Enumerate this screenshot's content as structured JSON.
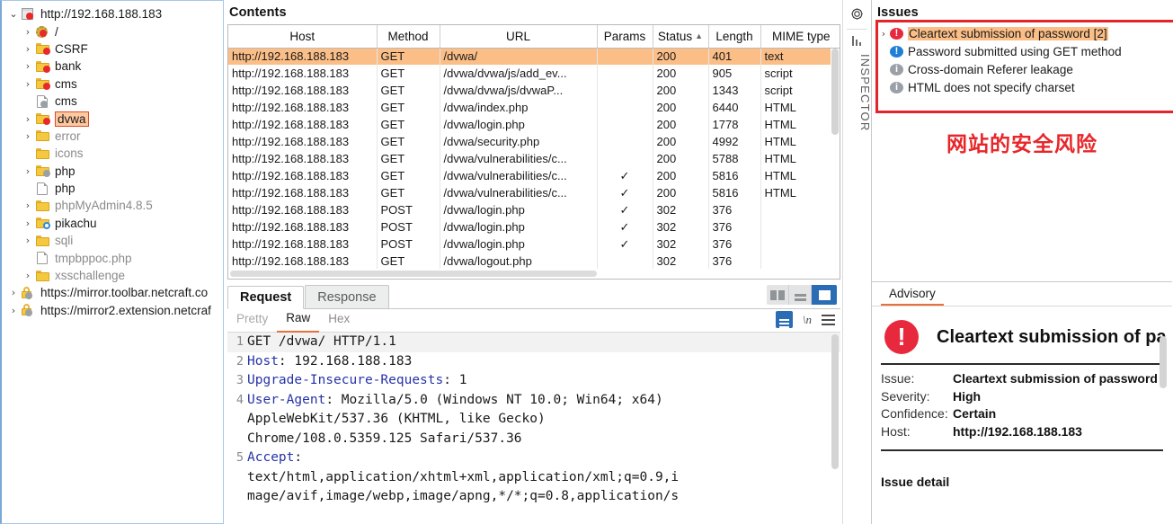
{
  "sidebar": {
    "tree": [
      {
        "depth": 0,
        "twist": "open",
        "icon": "box-icon",
        "badge": "red",
        "label": "http://192.168.188.183",
        "dim": false,
        "selected": false
      },
      {
        "depth": 1,
        "twist": "closed",
        "icon": "gear-icon",
        "badge": "red",
        "label": "/",
        "dim": false,
        "selected": false
      },
      {
        "depth": 1,
        "twist": "closed",
        "icon": "folder-icon",
        "badge": "red",
        "label": "CSRF",
        "dim": false,
        "selected": false
      },
      {
        "depth": 1,
        "twist": "closed",
        "icon": "folder-icon",
        "badge": "red",
        "label": "bank",
        "dim": false,
        "selected": false
      },
      {
        "depth": 1,
        "twist": "closed",
        "icon": "folder-icon",
        "badge": "red",
        "label": "cms",
        "dim": false,
        "selected": false
      },
      {
        "depth": 1,
        "twist": "none",
        "icon": "page-icon",
        "badge": "gray",
        "label": "cms",
        "dim": false,
        "selected": false
      },
      {
        "depth": 1,
        "twist": "closed",
        "icon": "folder-icon",
        "badge": "red",
        "label": "dvwa",
        "dim": false,
        "selected": true
      },
      {
        "depth": 1,
        "twist": "closed",
        "icon": "folder-icon",
        "badge": "none",
        "label": "error",
        "dim": true,
        "selected": false
      },
      {
        "depth": 1,
        "twist": "none",
        "icon": "folder-icon",
        "badge": "none",
        "label": "icons",
        "dim": true,
        "selected": false
      },
      {
        "depth": 1,
        "twist": "closed",
        "icon": "folder-icon",
        "badge": "gray",
        "label": "php",
        "dim": false,
        "selected": false
      },
      {
        "depth": 1,
        "twist": "none",
        "icon": "page-icon",
        "badge": "none",
        "label": "php",
        "dim": false,
        "selected": false
      },
      {
        "depth": 1,
        "twist": "closed",
        "icon": "folder-icon",
        "badge": "none",
        "label": "phpMyAdmin4.8.5",
        "dim": true,
        "selected": false
      },
      {
        "depth": 1,
        "twist": "closed",
        "icon": "folder-icon",
        "badge": "blue",
        "label": "pikachu",
        "dim": false,
        "selected": false
      },
      {
        "depth": 1,
        "twist": "closed",
        "icon": "folder-icon",
        "badge": "none",
        "label": "sqli",
        "dim": true,
        "selected": false
      },
      {
        "depth": 1,
        "twist": "none",
        "icon": "page-icon",
        "badge": "none",
        "label": "tmpbppoc.php",
        "dim": true,
        "selected": false
      },
      {
        "depth": 1,
        "twist": "closed",
        "icon": "folder-icon",
        "badge": "none",
        "label": "xsschallenge",
        "dim": true,
        "selected": false
      },
      {
        "depth": 0,
        "twist": "closed",
        "icon": "lock-icon",
        "badge": "gray",
        "label": "https://mirror.toolbar.netcraft.co",
        "dim": false,
        "selected": false
      },
      {
        "depth": 0,
        "twist": "closed",
        "icon": "lock-icon",
        "badge": "gray",
        "label": "https://mirror2.extension.netcraf",
        "dim": false,
        "selected": false
      }
    ]
  },
  "contents": {
    "title": "Contents",
    "columns": [
      "Host",
      "Method",
      "URL",
      "Params",
      "Status",
      "Length",
      "MIME type"
    ],
    "sorted_column": "Status",
    "sort_direction": "asc",
    "rows": [
      {
        "host": "http://192.168.188.183",
        "method": "GET",
        "url": "/dvwa/",
        "params": "",
        "status": "200",
        "length": "401",
        "mime": "text",
        "selected": true
      },
      {
        "host": "http://192.168.188.183",
        "method": "GET",
        "url": "/dvwa/dvwa/js/add_ev...",
        "params": "",
        "status": "200",
        "length": "905",
        "mime": "script",
        "selected": false
      },
      {
        "host": "http://192.168.188.183",
        "method": "GET",
        "url": "/dvwa/dvwa/js/dvwaP...",
        "params": "",
        "status": "200",
        "length": "1343",
        "mime": "script",
        "selected": false
      },
      {
        "host": "http://192.168.188.183",
        "method": "GET",
        "url": "/dvwa/index.php",
        "params": "",
        "status": "200",
        "length": "6440",
        "mime": "HTML",
        "selected": false
      },
      {
        "host": "http://192.168.188.183",
        "method": "GET",
        "url": "/dvwa/login.php",
        "params": "",
        "status": "200",
        "length": "1778",
        "mime": "HTML",
        "selected": false
      },
      {
        "host": "http://192.168.188.183",
        "method": "GET",
        "url": "/dvwa/security.php",
        "params": "",
        "status": "200",
        "length": "4992",
        "mime": "HTML",
        "selected": false
      },
      {
        "host": "http://192.168.188.183",
        "method": "GET",
        "url": "/dvwa/vulnerabilities/c...",
        "params": "",
        "status": "200",
        "length": "5788",
        "mime": "HTML",
        "selected": false
      },
      {
        "host": "http://192.168.188.183",
        "method": "GET",
        "url": "/dvwa/vulnerabilities/c...",
        "params": "✓",
        "status": "200",
        "length": "5816",
        "mime": "HTML",
        "selected": false
      },
      {
        "host": "http://192.168.188.183",
        "method": "GET",
        "url": "/dvwa/vulnerabilities/c...",
        "params": "✓",
        "status": "200",
        "length": "5816",
        "mime": "HTML",
        "selected": false
      },
      {
        "host": "http://192.168.188.183",
        "method": "POST",
        "url": "/dvwa/login.php",
        "params": "✓",
        "status": "302",
        "length": "376",
        "mime": "",
        "selected": false
      },
      {
        "host": "http://192.168.188.183",
        "method": "POST",
        "url": "/dvwa/login.php",
        "params": "✓",
        "status": "302",
        "length": "376",
        "mime": "",
        "selected": false
      },
      {
        "host": "http://192.168.188.183",
        "method": "POST",
        "url": "/dvwa/login.php",
        "params": "✓",
        "status": "302",
        "length": "376",
        "mime": "",
        "selected": false
      },
      {
        "host": "http://192.168.188.183",
        "method": "GET",
        "url": "/dvwa/logout.php",
        "params": "",
        "status": "302",
        "length": "376",
        "mime": "",
        "selected": false
      }
    ]
  },
  "editor": {
    "tabs": [
      {
        "label": "Request",
        "active": true
      },
      {
        "label": "Response",
        "active": false
      }
    ],
    "view_modes": [
      "split-view-icon",
      "stacked-view-icon",
      "single-view-icon"
    ],
    "active_view_mode": "single-view-icon",
    "subtabs": [
      {
        "label": "Pretty",
        "active": false,
        "disabled": true
      },
      {
        "label": "Raw",
        "active": true,
        "disabled": false
      },
      {
        "label": "Hex",
        "active": false,
        "disabled": false
      }
    ],
    "sub_icons": [
      "wordwrap-icon",
      "newline-icon",
      "menu-icon"
    ],
    "lines": [
      {
        "num": "1",
        "highlight": true,
        "header": "",
        "rest": "GET /dvwa/ HTTP/1.1"
      },
      {
        "num": "2",
        "highlight": false,
        "header": "Host",
        "rest": ": 192.168.188.183"
      },
      {
        "num": "3",
        "highlight": false,
        "header": "Upgrade-Insecure-Requests",
        "rest": ": 1"
      },
      {
        "num": "4",
        "highlight": false,
        "header": "User-Agent",
        "rest": ": Mozilla/5.0 (Windows NT 10.0; Win64; x64)"
      },
      {
        "num": "",
        "highlight": false,
        "header": "",
        "rest": "AppleWebKit/537.36 (KHTML, like Gecko)"
      },
      {
        "num": "",
        "highlight": false,
        "header": "",
        "rest": "Chrome/108.0.5359.125 Safari/537.36"
      },
      {
        "num": "5",
        "highlight": false,
        "header": "Accept",
        "rest": ":"
      },
      {
        "num": "",
        "highlight": false,
        "header": "",
        "rest": "text/html,application/xhtml+xml,application/xml;q=0.9,i"
      },
      {
        "num": "",
        "highlight": false,
        "header": "",
        "rest": "mage/avif,image/webp,image/apng,*/*;q=0.8,application/s"
      }
    ]
  },
  "rail": {
    "gear_icon": "gear-icon",
    "inspector_label": "INSPECTOR"
  },
  "issues": {
    "title": "Issues",
    "items": [
      {
        "twist": "closed",
        "severity": "high",
        "glyph": "!",
        "label": "Cleartext submission of password [2]",
        "selected": true
      },
      {
        "twist": "none",
        "severity": "med",
        "glyph": "!",
        "label": "Password submitted using GET method",
        "selected": false
      },
      {
        "twist": "none",
        "severity": "info",
        "glyph": "i",
        "label": "Cross-domain Referer leakage",
        "selected": false
      },
      {
        "twist": "none",
        "severity": "info",
        "glyph": "i",
        "label": "HTML does not specify charset",
        "selected": false
      }
    ],
    "annotation": "网站的安全风险",
    "annotation_color": "#e8262a",
    "highlight_box_color": "#e3252a"
  },
  "advisory": {
    "tab_label": "Advisory",
    "heading": "Cleartext submission of passw",
    "badge_glyph": "!",
    "fields": [
      {
        "key": "Issue:",
        "value": "Cleartext submission of password"
      },
      {
        "key": "Severity:",
        "value": "High"
      },
      {
        "key": "Confidence:",
        "value": "Certain"
      },
      {
        "key": "Host:",
        "value": "http://192.168.188.183"
      }
    ],
    "detail_heading": "Issue detail"
  }
}
